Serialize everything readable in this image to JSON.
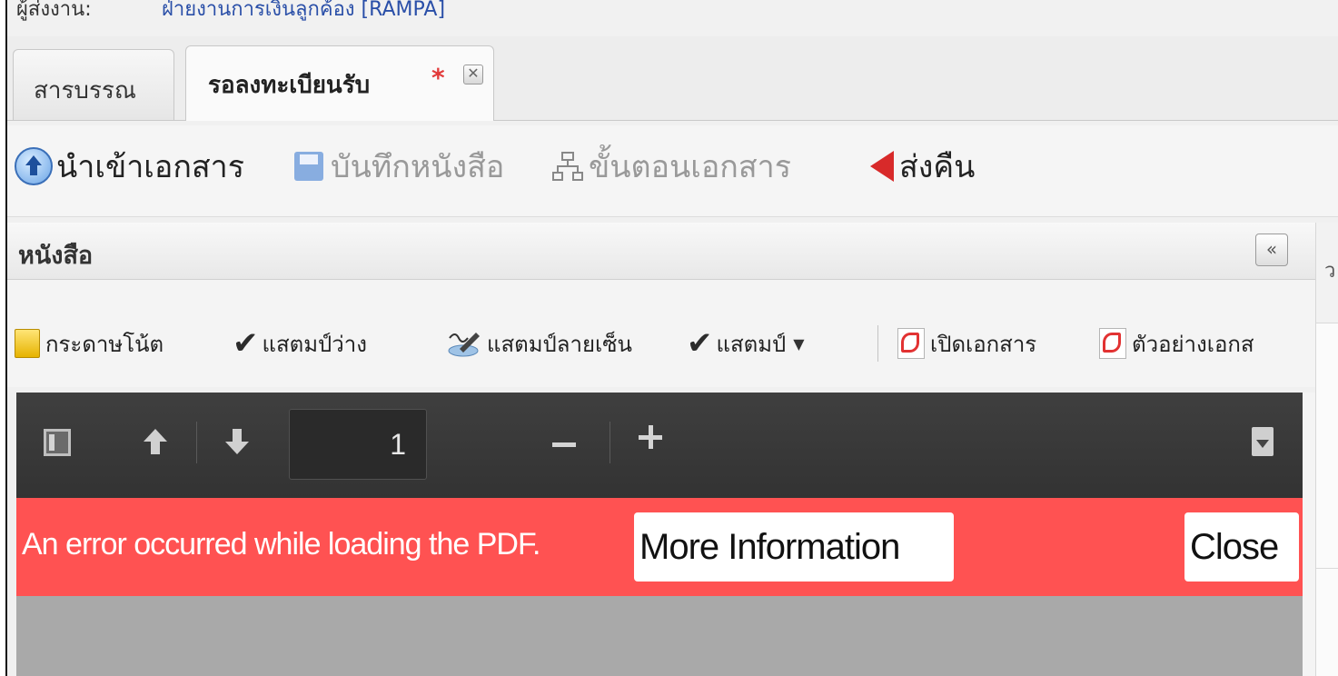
{
  "top": {
    "label": "ผู้ส่งงาน:",
    "value": "ฝ่ายงานการเงินลูกค้อง [RAMPA]"
  },
  "tabs": [
    {
      "label": "สารบรรณ",
      "active": false
    },
    {
      "label": "รอลงทะเบียนรับ",
      "active": true,
      "modified_marker": "*"
    }
  ],
  "toolbar": {
    "import": "นำเข้าเอกสาร",
    "save": "บันทึกหนังสือ",
    "workflow": "ขั้นตอนเอกสาร",
    "return": "ส่งคืน"
  },
  "panel": {
    "title": "หนังสือ",
    "collapse_icon": "«",
    "right_cut": "ว"
  },
  "doc_toolbar": {
    "note": "กระดาษโน้ต",
    "blank_stamp": "แสตมป์ว่าง",
    "signature_stamp": "แสตมป์ลายเซ็น",
    "stamp": "แสตมป์",
    "open_doc": "เปิดเอกสาร",
    "preview_doc": "ตัวอย่างเอกส"
  },
  "pdf_viewer": {
    "page_number": "1",
    "error_message": "An error occurred while loading the PDF.",
    "more_info": "More Information",
    "close": "Close"
  },
  "colors": {
    "error_bg": "#ff5252",
    "viewer_bar": "#3a3a3a",
    "accent_red": "#d82a2a"
  }
}
